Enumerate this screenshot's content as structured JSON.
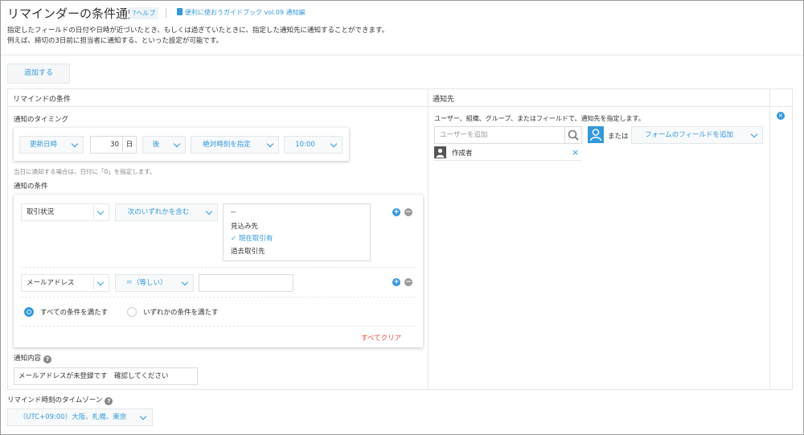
{
  "header": {
    "title": "リマインダーの条件通知",
    "help_label": "?ヘルプ",
    "guide_label": "便利に使おうガイドブック vol.09 通知編",
    "description_lines": [
      "指定したフィールドの日付や日時が近づいたとき、もしくは過ぎていたときに、指定した通知先に通知することができます。",
      "例えば、締切の3日前に担当者に通知する、といった設定が可能です。"
    ]
  },
  "toolbar": {
    "add_label": "追加する"
  },
  "table": {
    "col_condition": "リマインドの条件",
    "col_recipient": "通知先"
  },
  "timing": {
    "label": "通知のタイミング",
    "field_select": "更新日時",
    "days_value": "30",
    "days_unit": "日",
    "direction_select": "後",
    "time_mode_select": "絶対時刻を指定",
    "time_select": "10:00",
    "note": "当日に通知する場合は、日付に「0」を指定します。"
  },
  "conditions": {
    "label": "通知の条件",
    "rows": [
      {
        "field": "取引状況",
        "operator": "次のいずれかを含む",
        "options": [
          "--",
          "見込み先",
          "現在取引有",
          "過去取引先"
        ],
        "selected_option": "現在取引有"
      },
      {
        "field": "メールアドレス",
        "operator": "＝（等しい）",
        "value": ""
      }
    ],
    "match_all_label": "すべての条件を満たす",
    "match_any_label": "いずれかの条件を満たす",
    "match_selected": "all",
    "clear_all_label": "すべてクリア"
  },
  "content": {
    "label": "通知内容",
    "value": "メールアドレスが未登録です　確認してください"
  },
  "recipient": {
    "description": "ユーザー、組織、グループ、またはフィールドで、通知先を指定します。",
    "search_placeholder": "ユーザーを追加",
    "or_label": "または",
    "field_select": "フォームのフィールドを追加",
    "entries": [
      "作成者"
    ]
  },
  "timezone": {
    "label": "リマインド時刻のタイムゾーン",
    "value": "（UTC+09:00）大阪、札幌、東京"
  },
  "colors": {
    "accent": "#3498db",
    "danger": "#e74c3c",
    "border": "#e3e7e8"
  },
  "icons": [
    "help-icon",
    "book-icon",
    "chevron-down-icon",
    "plus-icon",
    "minus-icon",
    "search-icon",
    "person-icon",
    "user-avatar-icon",
    "close-icon",
    "remove-row-icon",
    "question-icon"
  ]
}
